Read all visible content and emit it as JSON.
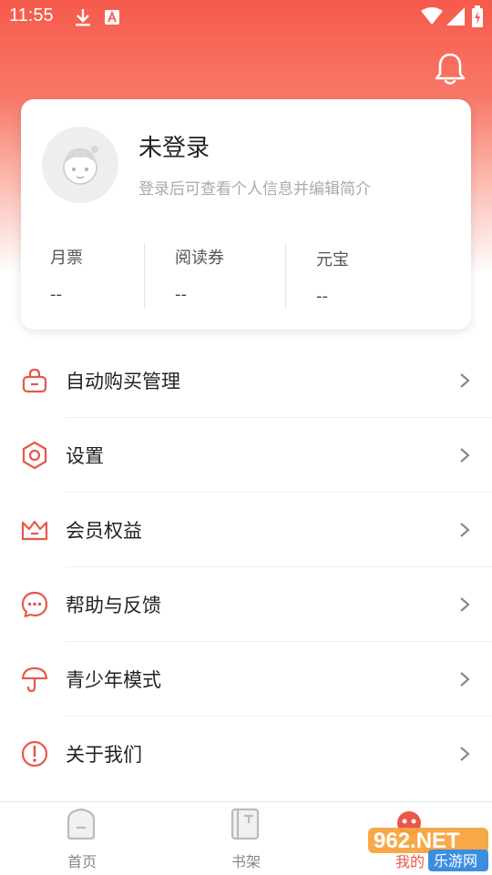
{
  "status_bar": {
    "time": "11:55"
  },
  "profile": {
    "username": "未登录",
    "hint": "登录后可查看个人信息并编辑简介",
    "stats": [
      {
        "label": "月票",
        "value": "--"
      },
      {
        "label": "阅读券",
        "value": "--"
      },
      {
        "label": "元宝",
        "value": "--"
      }
    ]
  },
  "menu": {
    "items": [
      {
        "label": "自动购买管理",
        "icon": "bag-icon"
      },
      {
        "label": "设置",
        "icon": "hexagon-settings-icon"
      },
      {
        "label": "会员权益",
        "icon": "crown-icon"
      },
      {
        "label": "帮助与反馈",
        "icon": "chat-bubble-icon"
      },
      {
        "label": "青少年模式",
        "icon": "umbrella-icon"
      },
      {
        "label": "关于我们",
        "icon": "info-icon"
      }
    ]
  },
  "tabbar": {
    "tabs": [
      {
        "label": "首页"
      },
      {
        "label": "书架"
      },
      {
        "label": "我的"
      }
    ]
  },
  "watermark": {
    "text": "962.NET",
    "subtext": "乐游网"
  },
  "colors": {
    "accent": "#f65a4b",
    "icon_red": "#e9574a"
  }
}
